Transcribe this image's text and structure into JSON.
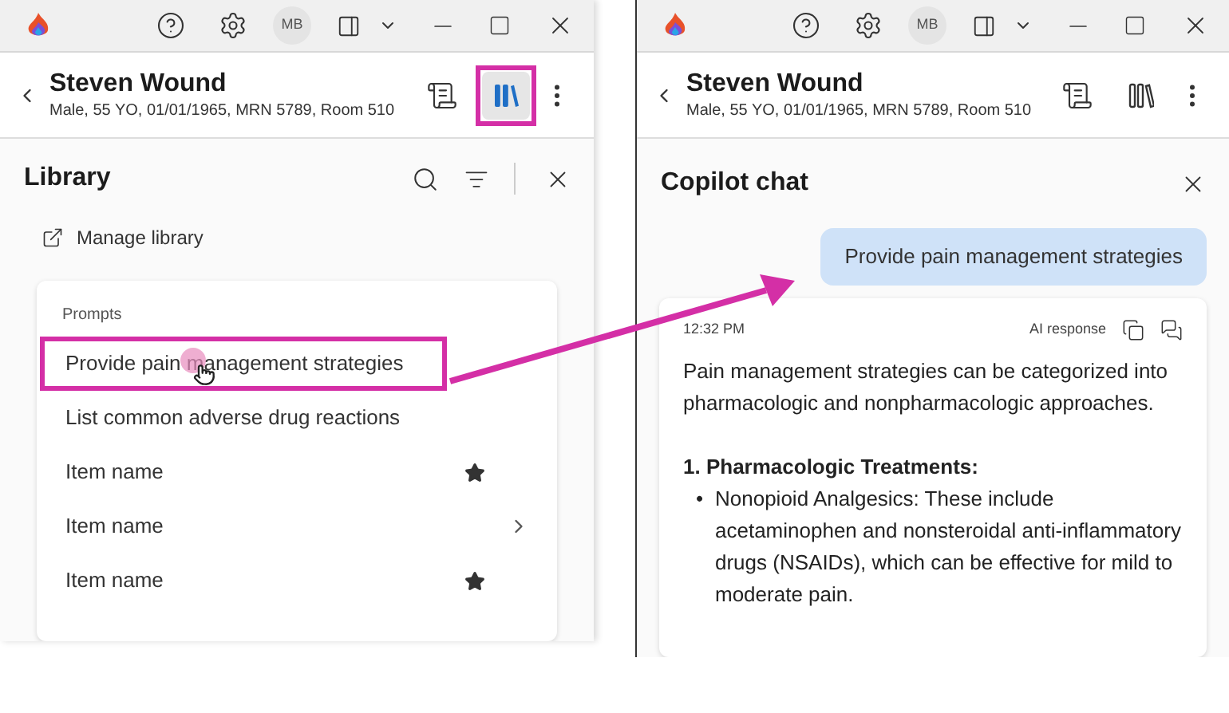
{
  "library_window": {
    "avatar": "MB",
    "patient": {
      "name": "Steven Wound",
      "details": "Male, 55 YO, 01/01/1965, MRN 5789, Room 510"
    },
    "header_buttons": [
      {
        "kind": "notes",
        "highlighted": false,
        "selected": false
      },
      {
        "kind": "library",
        "highlighted": true,
        "selected": true
      }
    ],
    "title": "Library",
    "manage_link": "Manage library",
    "section": "Prompts",
    "items": [
      {
        "label": "Provide pain management strategies",
        "kind": "plain",
        "highlighted": true
      },
      {
        "label": "List common adverse drug reactions",
        "kind": "plain",
        "highlighted": false
      },
      {
        "label": "Item name",
        "kind": "star",
        "highlighted": false
      },
      {
        "label": "Item name",
        "kind": "chevron",
        "highlighted": false
      },
      {
        "label": "Item name",
        "kind": "star",
        "highlighted": false
      }
    ]
  },
  "chat_window": {
    "avatar": "MB",
    "patient": {
      "name": "Steven Wound",
      "details": "Male, 55 YO, 01/01/1965, MRN 5789, Room 510"
    },
    "header_buttons": [
      {
        "kind": "notes",
        "highlighted": false,
        "selected": false
      },
      {
        "kind": "library",
        "highlighted": false,
        "selected": false
      }
    ],
    "title": "Copilot chat",
    "user_message": "Provide pain management strategies",
    "response": {
      "time": "12:32 PM",
      "label": "AI response",
      "intro": "Pain management strategies can be categorized into pharmacologic and nonpharmacologic approaches.",
      "heading": "1. Pharmacologic Treatments:",
      "bullets": [
        {
          "marker": "•",
          "text": "Nonopioid Analgesics: These include acetaminophen and nonsteroidal anti-inflammatory drugs (NSAIDs), which can be effective for mild to moderate pain."
        }
      ]
    }
  }
}
